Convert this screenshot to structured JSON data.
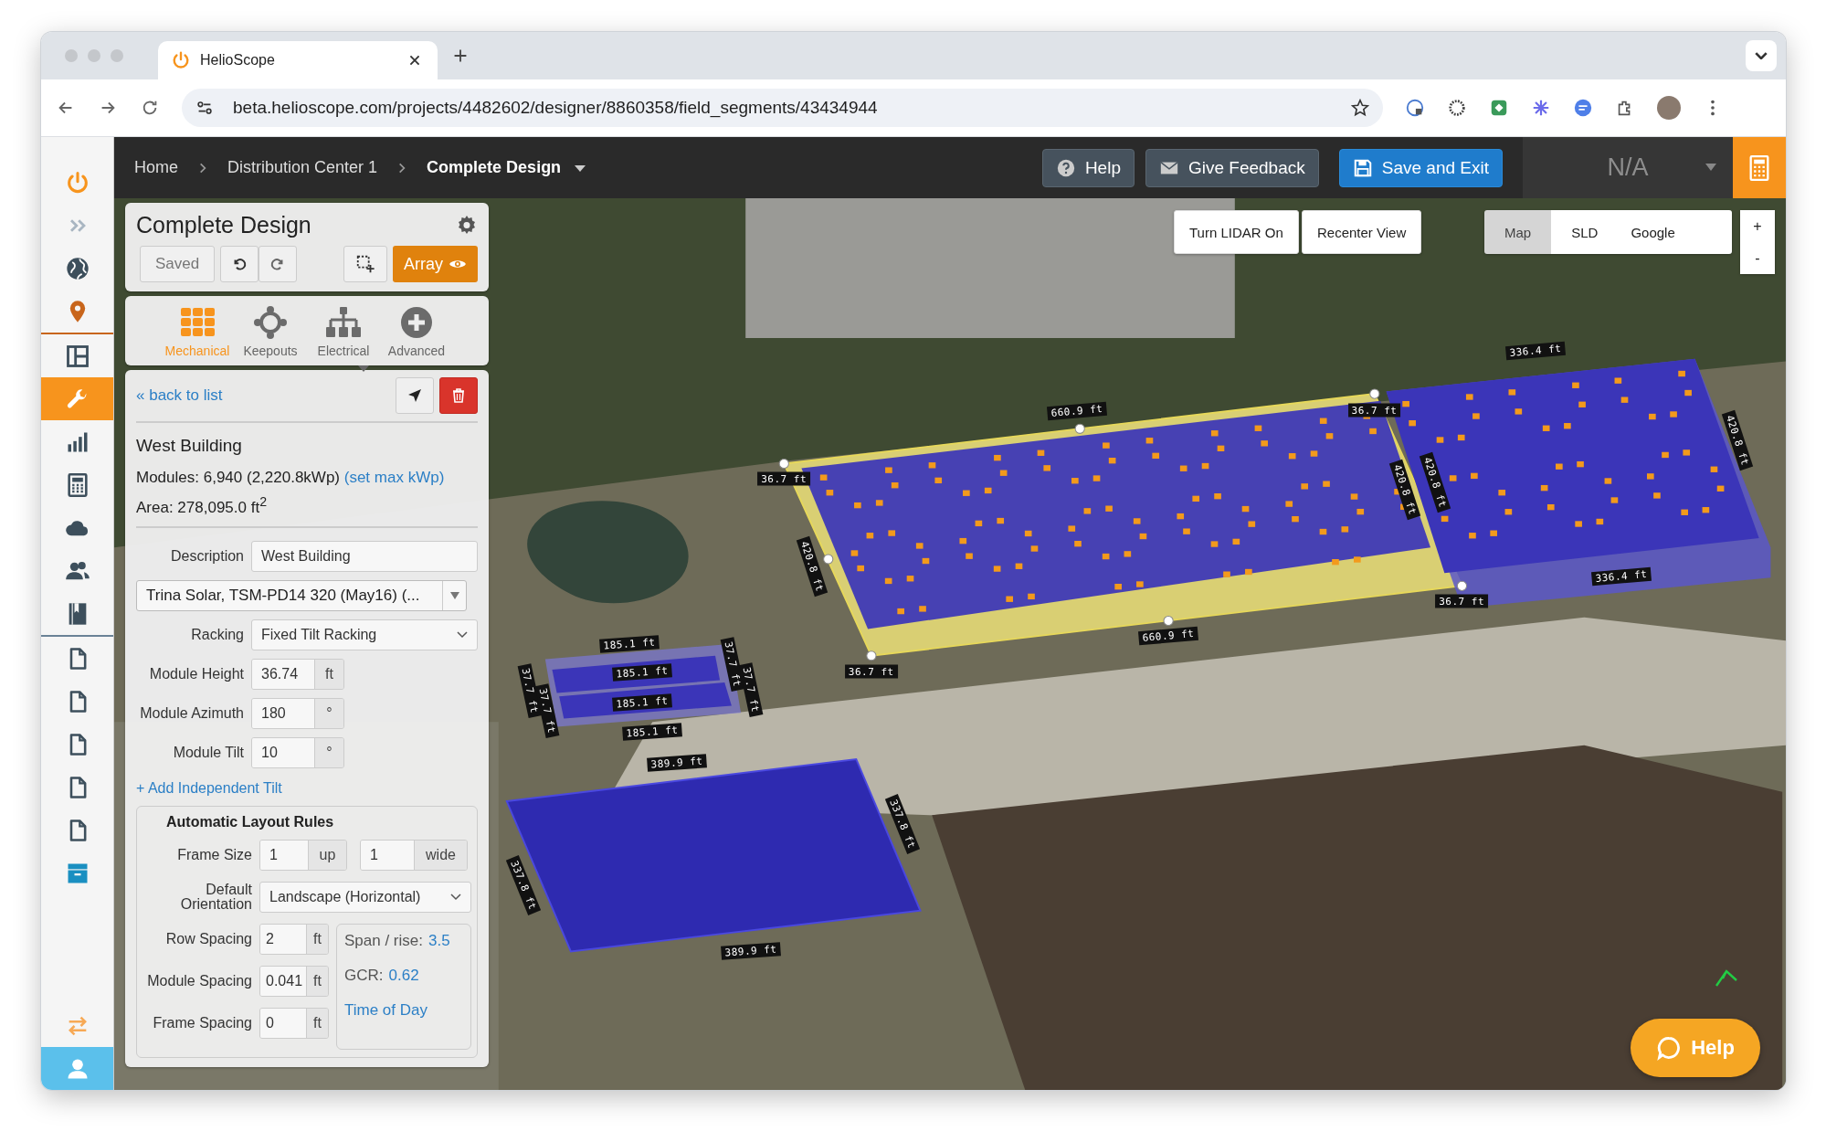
{
  "browser": {
    "tab_title": "HelioScope",
    "url": "beta.helioscope.com/projects/4482602/designer/8860358/field_segments/43434944"
  },
  "sidebar": {
    "items": [
      {
        "selected": false
      },
      {
        "selected": false
      },
      {
        "selected": false
      },
      {
        "selected": false
      },
      {
        "selected": false
      },
      {
        "selected": true
      },
      {
        "selected": false
      },
      {
        "selected": false
      },
      {
        "selected": false
      },
      {
        "selected": false
      },
      {
        "selected": false
      },
      {
        "selected": false
      },
      {
        "selected": false
      },
      {
        "selected": false
      },
      {
        "selected": false
      },
      {
        "selected": false
      },
      {
        "selected": false
      },
      {
        "selected": false
      },
      {
        "selected": false
      }
    ]
  },
  "topbar": {
    "breadcrumbs": [
      "Home",
      "Distribution Center 1",
      "Complete Design"
    ],
    "help": "Help",
    "feedback": "Give Feedback",
    "save": "Save and Exit",
    "selector": "N/A"
  },
  "panel": {
    "title": "Complete Design",
    "saved": "Saved",
    "array": "Array",
    "tabs": [
      {
        "label": "Mechanical",
        "selected": true
      },
      {
        "label": "Keepouts",
        "selected": false
      },
      {
        "label": "Electrical",
        "selected": false
      },
      {
        "label": "Advanced",
        "selected": false
      }
    ],
    "back": "« back to list",
    "segment": "West Building",
    "modules": "Modules: 6,940 (2,220.8kWp)",
    "set_max": "(set max kWp)",
    "area": "Area: 278,095.0 ft$^{2}$",
    "fields": [
      {
        "kind": "text",
        "label": "Description",
        "value": "West Building"
      },
      {
        "kind": "combo",
        "value": "Trina Solar, TSM-PD14 320 (May16) (..."
      },
      {
        "kind": "select",
        "label": "Racking",
        "value": "Fixed Tilt Racking"
      },
      {
        "kind": "unit",
        "label": "Module Height",
        "value": "36.74",
        "unit": "ft"
      },
      {
        "kind": "unit",
        "label": "Module Azimuth",
        "value": "180",
        "unit": "°"
      },
      {
        "kind": "unit",
        "label": "Module Tilt",
        "value": "10",
        "unit": "°"
      }
    ],
    "add_tilt": "+ Add Independent Tilt",
    "layout_rules": {
      "title": "Automatic Layout Rules",
      "frame_size": {
        "label": "Frame Size",
        "up": "1",
        "up_unit": "up",
        "wide": "1",
        "wide_unit": "wide"
      },
      "orientation": {
        "label": "Default Orientation",
        "value": "Landscape (Horizontal)"
      },
      "spacing": [
        {
          "label": "Row Spacing",
          "value": "2",
          "unit": "ft"
        },
        {
          "label": "Module Spacing",
          "value": "0.041",
          "unit": "ft"
        },
        {
          "label": "Frame Spacing",
          "value": "0",
          "unit": "ft"
        }
      ],
      "span_rise": {
        "label": "Span / rise:",
        "value": "3.5"
      },
      "gcr": {
        "label": "GCR:",
        "value": "0.62"
      },
      "time_of_day": "Time of Day"
    }
  },
  "map": {
    "lidar": "Turn LIDAR On",
    "recenter": "Recenter View",
    "layers": [
      {
        "label": "Map",
        "selected": true
      },
      {
        "label": "SLD",
        "selected": false
      },
      {
        "label": "Google",
        "selected": false
      }
    ],
    "zoom_in": "+",
    "zoom_out": "-",
    "help": "Help",
    "dimension_labels": [
      "336.4 ft",
      "660.9 ft",
      "36.7 ft",
      "36.7 ft",
      "420.8 ft",
      "420.8 ft",
      "420.8 ft",
      "420.8 ft",
      "336.4 ft",
      "36.7 ft",
      "660.9 ft",
      "185.1 ft",
      "36.7 ft",
      "185.1 ft",
      "37.7 ft",
      "37.7 ft",
      "37.7 ft",
      "37.7 ft",
      "185.1 ft",
      "185.1 ft",
      "389.9 ft",
      "337.8 ft",
      "337.8 ft",
      "389.9 ft"
    ]
  }
}
